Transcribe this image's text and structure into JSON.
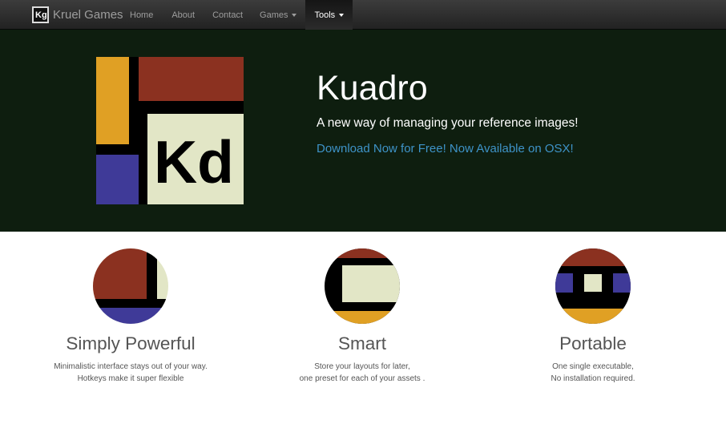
{
  "navbar": {
    "brand_icon": "Kg",
    "brand_name": "Kruel Games",
    "items": [
      {
        "label": "Home"
      },
      {
        "label": "About"
      },
      {
        "label": "Contact"
      },
      {
        "label": "Games",
        "dropdown": true
      },
      {
        "label": "Tools",
        "dropdown": true,
        "active": true
      }
    ]
  },
  "hero": {
    "logo_text": "Kd",
    "title": "Kuadro",
    "subtitle": "A new way of managing your reference images!",
    "download_link": "Download Now for Free! Now Available on OSX!"
  },
  "features": [
    {
      "icon": "simply-powerful-icon",
      "title": "Simply Powerful",
      "line1": "Minimalistic interface stays out of your way.",
      "line2": "Hotkeys make it super flexible"
    },
    {
      "icon": "smart-icon",
      "title": "Smart",
      "line1": "Store your layouts for later,",
      "line2": "one preset for each of your assets ."
    },
    {
      "icon": "portable-icon",
      "title": "Portable",
      "line1": "One single executable,",
      "line2": "No installation required."
    }
  ],
  "colors": {
    "navbar_bg": "#222222",
    "hero_bg": "#0e1e0f",
    "link": "#3e93c8",
    "brick_red": "#8b3120",
    "mustard": "#e0a024",
    "indigo": "#3f3a98",
    "cream": "#e2e6c6"
  }
}
